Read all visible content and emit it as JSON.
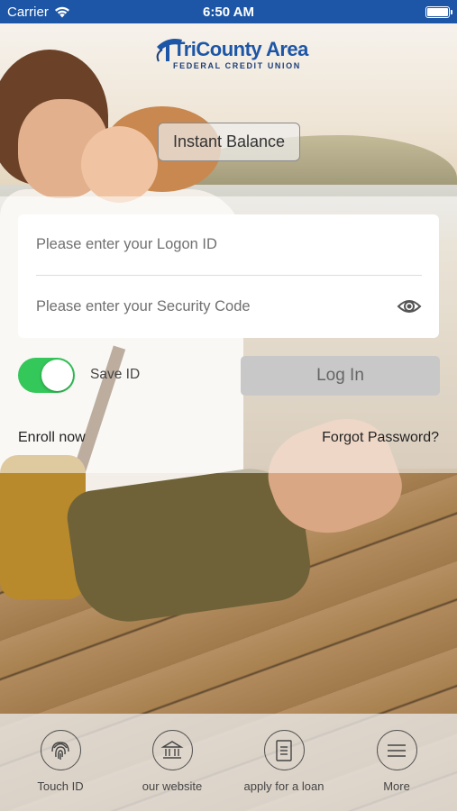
{
  "status_bar": {
    "carrier": "Carrier",
    "time": "6:50 AM"
  },
  "logo": {
    "name": "TriCounty Area",
    "tagline": "FEDERAL CREDIT UNION"
  },
  "instant_balance_label": "Instant Balance",
  "login": {
    "logon_placeholder": "Please enter your Logon ID",
    "logon_value": "",
    "security_placeholder": "Please enter your Security Code",
    "security_value": "",
    "save_id_label": "Save ID",
    "save_id_on": true,
    "login_label": "Log In"
  },
  "links": {
    "enroll": "Enroll now",
    "forgot": "Forgot Password?"
  },
  "bottom_nav": [
    {
      "label": "Touch ID",
      "icon": "fingerprint-icon"
    },
    {
      "label": "our website",
      "icon": "bank-icon"
    },
    {
      "label": "apply for a loan",
      "icon": "document-icon"
    },
    {
      "label": "More",
      "icon": "menu-icon"
    }
  ],
  "colors": {
    "brand_blue": "#1d56a6",
    "toggle_on": "#34c759"
  }
}
